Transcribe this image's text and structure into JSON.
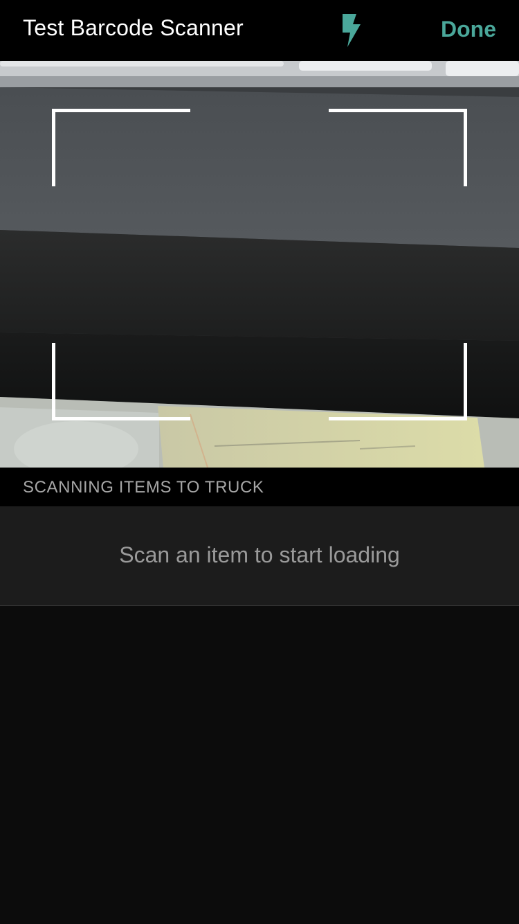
{
  "navbar": {
    "title": "Test Barcode Scanner",
    "flash_icon": "flash-icon",
    "done_label": "Done"
  },
  "camera": {
    "viewfinder": "camera-preview"
  },
  "list": {
    "section_header": "SCANNING ITEMS TO TRUCK",
    "empty_message": "Scan an item to start loading"
  },
  "colors": {
    "accent": "#4aa79a",
    "navbar_bg": "#000000",
    "list_bg": "#0c0c0c",
    "cell_bg": "#1c1c1c"
  }
}
